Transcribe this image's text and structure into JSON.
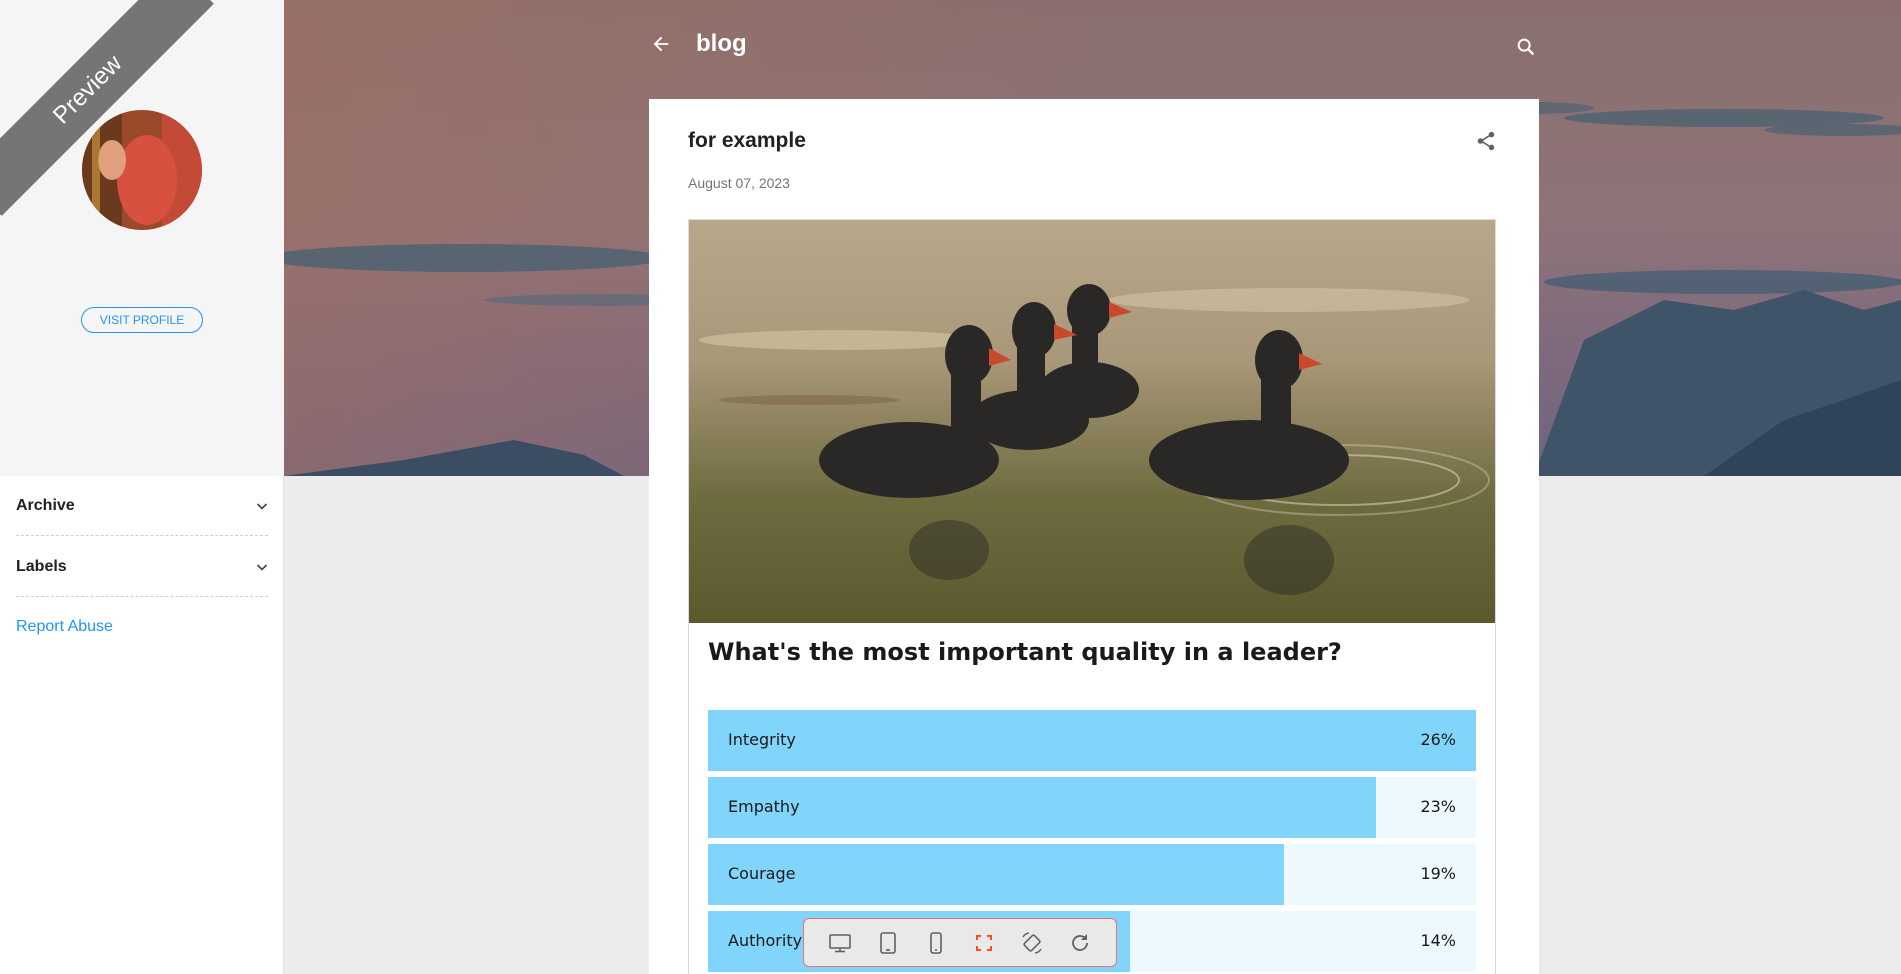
{
  "sidebar": {
    "ribbon_label": "Preview",
    "visit_profile_label": "VISIT PROFILE",
    "sections": [
      {
        "label": "Archive"
      },
      {
        "label": "Labels"
      }
    ],
    "report_abuse_label": "Report Abuse"
  },
  "header": {
    "blog_title": "blog"
  },
  "post": {
    "title": "for example",
    "date": "August 07, 2023"
  },
  "poll": {
    "question": "What's the most important quality in a leader?",
    "options": [
      {
        "label": "Integrity",
        "percent_label": "26%",
        "fill_fraction": 1.0
      },
      {
        "label": "Empathy",
        "percent_label": "23%",
        "fill_fraction": 0.87
      },
      {
        "label": "Courage",
        "percent_label": "19%",
        "fill_fraction": 0.75
      },
      {
        "label": "Authority",
        "percent_label": "14%",
        "fill_fraction": 0.55
      }
    ]
  },
  "toolbar": {
    "icons": [
      "desktop-icon",
      "tablet-icon",
      "phone-icon",
      "fullscreen-icon",
      "rotate-icon",
      "refresh-icon"
    ],
    "active_icon": "fullscreen-icon"
  },
  "colors": {
    "accent": "#2196f3",
    "bar_fill": "#81d4fa",
    "bar_track": "#eef8ff",
    "active_tool": "#f4511e"
  }
}
